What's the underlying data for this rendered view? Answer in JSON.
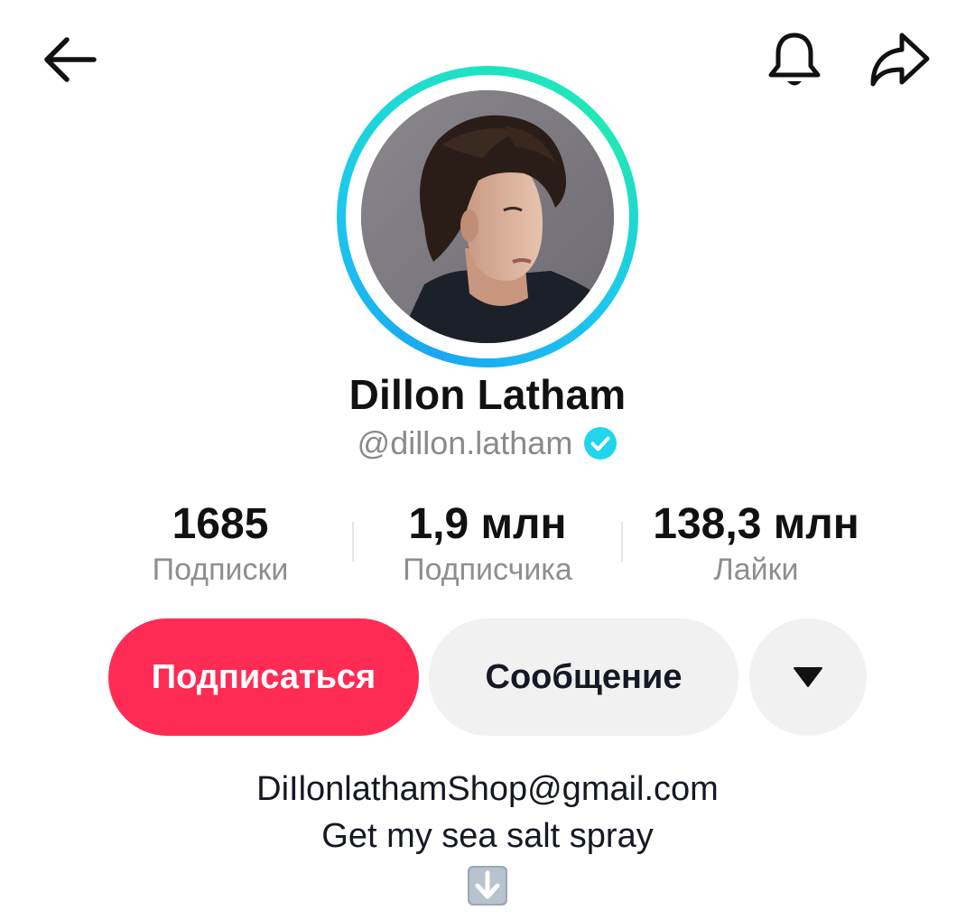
{
  "header": {
    "back_icon": "arrow-left-icon",
    "bell_icon": "bell-icon",
    "share_icon": "share-arrow-icon"
  },
  "profile": {
    "name": "Dillon Latham",
    "handle": "@dillon.latham",
    "verified_icon": "verified-badge-icon",
    "ring_colors": [
      "#1aa7f0",
      "#1ee0c8"
    ]
  },
  "stats": {
    "following": {
      "value": "1685",
      "label": "Подписки"
    },
    "followers": {
      "value": "1,9 млн",
      "label": "Подписчика"
    },
    "likes": {
      "value": "138,3 млн",
      "label": "Лайки"
    }
  },
  "actions": {
    "follow_label": "Подписаться",
    "message_label": "Сообщение",
    "more_icon": "caret-down-icon",
    "follow_color": "#fe2c55",
    "secondary_color": "#f1f1f2"
  },
  "bio": {
    "line1": "DiIlonlathamShop@gmail.com",
    "line2": "Get my sea salt spray",
    "emoji_icon": "down-arrow-emoji-icon"
  }
}
